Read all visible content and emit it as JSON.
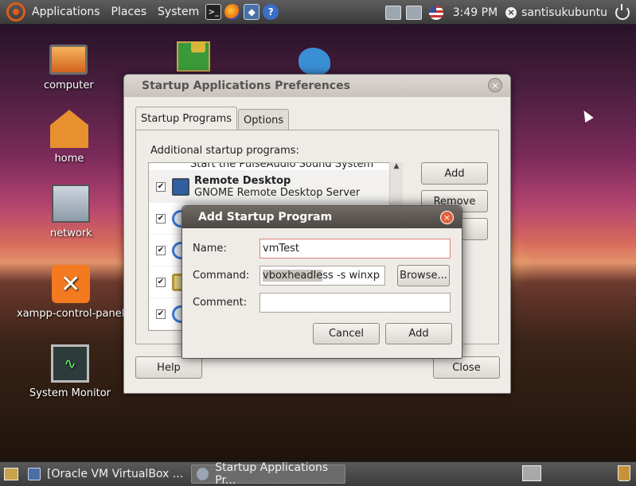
{
  "top_panel": {
    "menus": [
      "Applications",
      "Places",
      "System"
    ],
    "clock": "3:49 PM",
    "user": "santisukubuntu"
  },
  "desktop_icons": [
    {
      "label": "computer",
      "icon": "computer-icon"
    },
    {
      "label": "home",
      "icon": "home-folder-icon"
    },
    {
      "label": "network",
      "icon": "network-icon"
    },
    {
      "label": "xampp-control-panel",
      "icon": "xampp-icon"
    },
    {
      "label": "System Monitor",
      "icon": "system-monitor-icon"
    }
  ],
  "startup_window": {
    "title": "Startup Applications Preferences",
    "tabs": [
      "Startup Programs",
      "Options"
    ],
    "section_label": "Additional startup programs:",
    "partial_row_text": "Start the PulseAudio Sound System",
    "programs": [
      {
        "name": "Remote Desktop",
        "description": "GNOME Remote Desktop Server",
        "checked": "✔"
      },
      {
        "name": "",
        "description": "",
        "checked": "✔"
      },
      {
        "name": "",
        "description": "",
        "checked": "✔"
      },
      {
        "name": "",
        "description": "",
        "checked": "✔"
      },
      {
        "name": "",
        "description": "",
        "checked": "✔"
      }
    ],
    "scroll_up": "▲",
    "buttons": {
      "add": "Add",
      "remove": "Remove",
      "help": "Help",
      "close": "Close"
    },
    "close_glyph": "×"
  },
  "add_dialog": {
    "title": "Add Startup Program",
    "close_glyph": "×",
    "name_label": "Name:",
    "name_value": "vmTest",
    "command_label": "Command:",
    "command_selected": "vboxheadle",
    "command_rest": "ss -s winxp",
    "comment_label": "Comment:",
    "comment_value": "",
    "browse": "Browse...",
    "cancel": "Cancel",
    "add": "Add"
  },
  "taskbar": {
    "tasks": [
      {
        "label": "[Oracle VM VirtualBox ...",
        "icon": "virtualbox-icon"
      },
      {
        "label": "Startup Applications Pr...",
        "icon": "startup-apps-icon"
      }
    ]
  }
}
